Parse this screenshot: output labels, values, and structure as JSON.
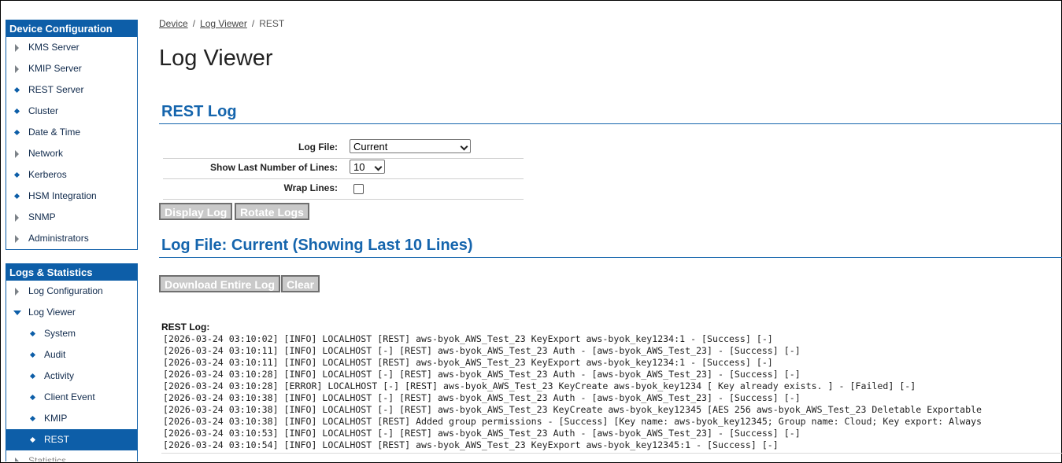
{
  "sidebar": {
    "device_config": {
      "title": "Device Configuration",
      "items": [
        {
          "label": "KMS Server",
          "marker": "triangle"
        },
        {
          "label": "KMIP Server",
          "marker": "triangle"
        },
        {
          "label": "REST Server",
          "marker": "dot"
        },
        {
          "label": "Cluster",
          "marker": "dot"
        },
        {
          "label": "Date & Time",
          "marker": "dot"
        },
        {
          "label": "Network",
          "marker": "triangle"
        },
        {
          "label": "Kerberos",
          "marker": "dot"
        },
        {
          "label": "HSM Integration",
          "marker": "dot"
        },
        {
          "label": "SNMP",
          "marker": "triangle"
        },
        {
          "label": "Administrators",
          "marker": "triangle"
        }
      ]
    },
    "logs_stats": {
      "title": "Logs & Statistics",
      "items": [
        {
          "label": "Log Configuration"
        },
        {
          "label": "Log Viewer"
        },
        {
          "label": "System"
        },
        {
          "label": "Audit"
        },
        {
          "label": "Activity"
        },
        {
          "label": "Client Event"
        },
        {
          "label": "KMIP"
        },
        {
          "label": "REST"
        },
        {
          "label": "Statistics"
        }
      ]
    }
  },
  "breadcrumb": {
    "device": "Device",
    "log_viewer": "Log Viewer",
    "current": "REST",
    "sep": "/"
  },
  "page_title": "Log Viewer",
  "rest_log": {
    "title": "REST Log",
    "log_file_label": "Log File:",
    "log_file_value": "Current",
    "lines_label": "Show Last Number of Lines:",
    "lines_value": "10",
    "wrap_label": "Wrap Lines:",
    "display_btn": "Display Log",
    "rotate_btn": "Rotate Logs"
  },
  "log_file_section": {
    "title": "Log File: Current (Showing Last 10 Lines)",
    "download_btn": "Download Entire Log",
    "clear_btn": "Clear",
    "log_label": "REST Log:",
    "lines": [
      "[2026-03-24 03:10:02] [INFO] LOCALHOST [REST] aws-byok_AWS_Test_23 KeyExport aws-byok_key1234:1 - [Success] [-]",
      "[2026-03-24 03:10:11] [INFO] LOCALHOST [-] [REST] aws-byok_AWS_Test_23 Auth - [aws-byok_AWS_Test_23] - [Success] [-]",
      "[2026-03-24 03:10:11] [INFO] LOCALHOST [REST] aws-byok_AWS_Test_23 KeyExport aws-byok_key1234:1 - [Success] [-]",
      "[2026-03-24 03:10:28] [INFO] LOCALHOST [-] [REST] aws-byok_AWS_Test_23 Auth - [aws-byok_AWS_Test_23] - [Success] [-]",
      "[2026-03-24 03:10:28] [ERROR] LOCALHOST [-] [REST] aws-byok_AWS_Test_23 KeyCreate aws-byok_key1234 [ Key already exists. ] - [Failed] [-]",
      "[2026-03-24 03:10:38] [INFO] LOCALHOST [-] [REST] aws-byok_AWS_Test_23 Auth - [aws-byok_AWS_Test_23] - [Success] [-]",
      "[2026-03-24 03:10:38] [INFO] LOCALHOST [-] [REST] aws-byok_AWS_Test_23 KeyCreate aws-byok_key12345 [AES 256 aws-byok_AWS_Test_23 Deletable Exportable",
      "[2026-03-24 03:10:38] [INFO] LOCALHOST [REST] Added group permissions - [Success] [Key name: aws-byok_key12345; Group name: Cloud; Key export: Always",
      "[2026-03-24 03:10:53] [INFO] LOCALHOST [-] [REST] aws-byok_AWS_Test_23 Auth - [aws-byok_AWS_Test_23] - [Success] [-]",
      "[2026-03-24 03:10:54] [INFO] LOCALHOST [REST] aws-byok_AWS_Test_23 KeyExport aws-byok_key12345:1 - [Success] [-]"
    ]
  },
  "colors": {
    "accent": "#0d5ea8",
    "section_title": "#1565ad",
    "button_bg": "#c9c9c9"
  }
}
